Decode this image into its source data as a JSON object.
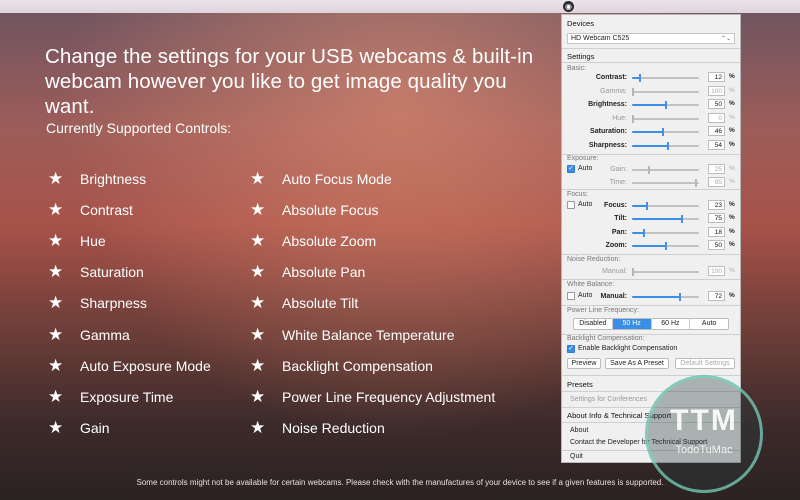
{
  "headline": "Change the settings for your USB webcams & built-in webcam however you like to get image quality you want.",
  "subheading": "Currently Supported Controls:",
  "controls_left": [
    "Brightness",
    "Contrast",
    "Hue",
    "Saturation",
    "Sharpness",
    "Gamma",
    "Auto Exposure Mode",
    "Exposure Time",
    "Gain"
  ],
  "controls_right": [
    "Auto Focus Mode",
    "Absolute Focus",
    "Absolute Zoom",
    "Absolute Pan",
    "Absolute Tilt",
    "White Balance Temperature",
    "Backlight Compensation",
    "Power Line Frequency Adjustment",
    "Noise Reduction"
  ],
  "star": "★",
  "footnote": "Some controls might not be available for certain webcams. Please check with the manufactures of your device to see if a given features is supported.",
  "panel": {
    "devices_title": "Devices",
    "device_selected": "HD Webcam C525",
    "settings_title": "Settings",
    "basic_label": "Basic:",
    "contrast": {
      "label": "Contrast:",
      "value": "12",
      "level": 12
    },
    "gamma": {
      "label": "Gamma:",
      "value": "100",
      "level": 0
    },
    "brightness": {
      "label": "Brightness:",
      "value": "50",
      "level": 50
    },
    "hue": {
      "label": "Hue:",
      "value": "0",
      "level": 0
    },
    "saturation": {
      "label": "Saturation:",
      "value": "46",
      "level": 46
    },
    "sharpness": {
      "label": "Sharpness:",
      "value": "54",
      "level": 54
    },
    "exposure_label": "Exposure:",
    "exposure_auto": "Auto",
    "gain": {
      "label": "Gain:",
      "value": "25",
      "level": 25
    },
    "time": {
      "label": "Time:",
      "value": "95",
      "level": 95
    },
    "focus_label": "Focus:",
    "focus_auto": "Auto",
    "focus": {
      "label": "Focus:",
      "value": "23",
      "level": 23
    },
    "tilt": {
      "label": "Tilt:",
      "value": "75",
      "level": 75
    },
    "pan": {
      "label": "Pan:",
      "value": "18",
      "level": 18
    },
    "zoom": {
      "label": "Zoom:",
      "value": "50",
      "level": 50
    },
    "noise_label": "Noise Reduction:",
    "manual_noise": {
      "label": "Manual:",
      "value": "100",
      "level": 0
    },
    "wb_label": "White Balance:",
    "wb_auto": "Auto",
    "wb_manual": {
      "label": "Manual:",
      "value": "72",
      "level": 72
    },
    "plf_label": "Power Line Frequency:",
    "plf_options": [
      "Disabled",
      "50 Hz",
      "60 Hz",
      "Auto"
    ],
    "backlight_label": "Backlight Compensation:",
    "backlight_check": "Enable Backlight Compensation",
    "preview_btn": "Preview",
    "save_preset_btn": "Save As A Preset",
    "default_btn": "Default Settings",
    "presets_title": "Presets",
    "presets_item": "Settings for Conferences",
    "about_title": "About Info & Technical Support",
    "about_item": "About",
    "contact_item": "Contact the Developer for Technical Support",
    "quit_item": "Quit",
    "pct": "%"
  },
  "watermark": {
    "text": "TTM",
    "subtext": "TodoTuMac"
  }
}
